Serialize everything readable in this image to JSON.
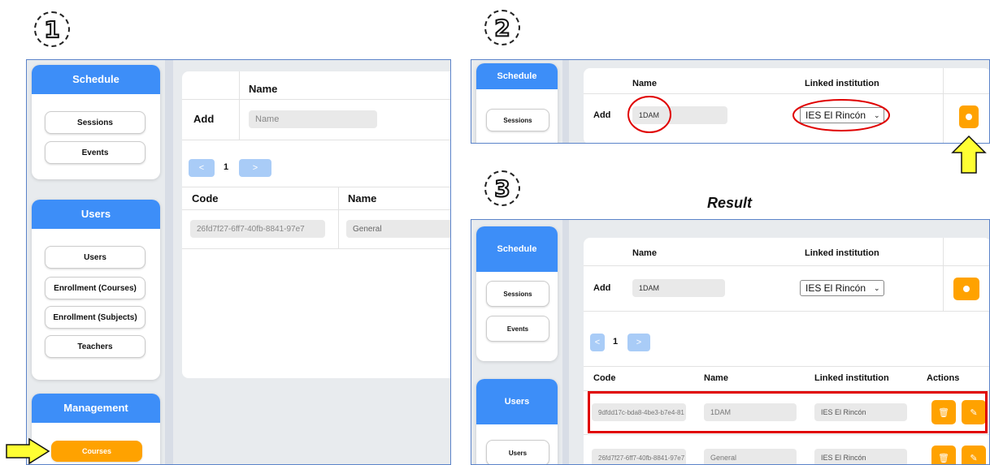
{
  "steps": [
    "1",
    "2",
    "3"
  ],
  "result_label": "Result",
  "sidebar": {
    "schedule": "Schedule",
    "sessions": "Sessions",
    "events": "Events",
    "users": "Users",
    "users_item": "Users",
    "enroll_courses": "Enrollment (Courses)",
    "enroll_subjects": "Enrollment (Subjects)",
    "teachers": "Teachers",
    "management": "Management",
    "courses": "Courses"
  },
  "form": {
    "name_header": "Name",
    "linked_header": "Linked institution",
    "add_label": "Add",
    "name_placeholder": "Name",
    "name_value": "1DAM",
    "institution_value": "IES El Rincón"
  },
  "pagination": {
    "prev": "<",
    "page": "1",
    "next": ">"
  },
  "table": {
    "headers": {
      "code": "Code",
      "name": "Name",
      "linked": "Linked institution",
      "actions": "Actions"
    },
    "rows": [
      {
        "code": "9dfdd17c-bda8-4be3-b7e4-81",
        "name": "1DAM",
        "linked": "IES El Rincón"
      },
      {
        "code": "26fd7f27-6ff7-40fb-8841-97e7",
        "name": "General",
        "linked": "IES El Rincón"
      }
    ],
    "panel1_row": {
      "code": "26fd7f27-6ff7-40fb-8841-97e7",
      "name": "General"
    }
  },
  "colors": {
    "accent": "#3d8ef8",
    "orange": "#ffa200",
    "highlight": "#e00000",
    "arrow": "#ffff33"
  }
}
